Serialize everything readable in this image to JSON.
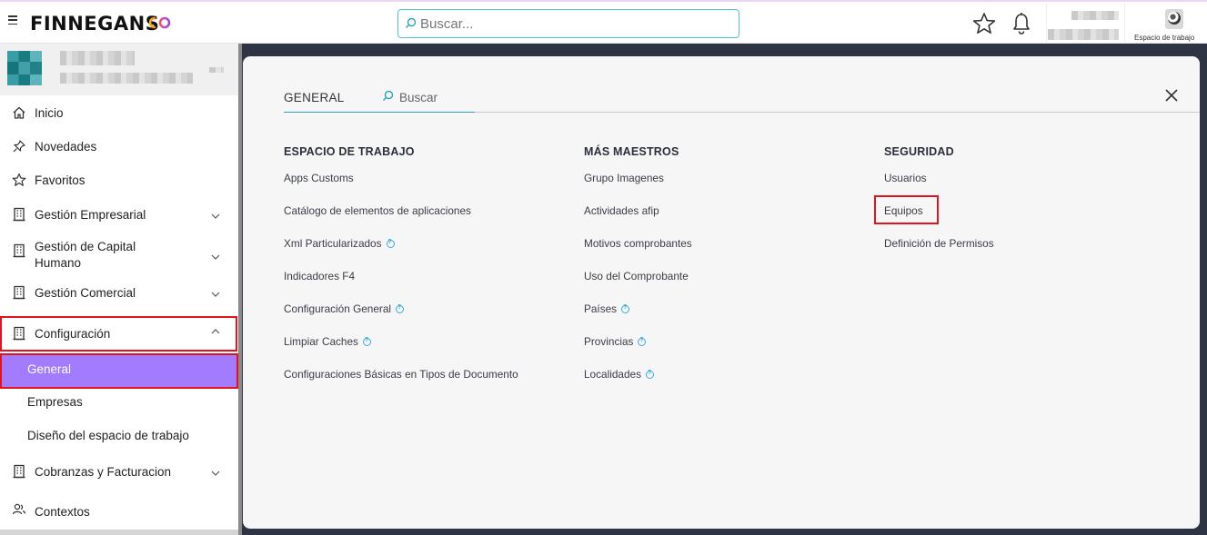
{
  "app": {
    "brand": "FINNEGANS"
  },
  "search": {
    "placeholder": "Buscar..."
  },
  "workspace": {
    "label": "Espacio de trabajo"
  },
  "sidebar": {
    "items": [
      {
        "label": "Inicio",
        "icon": "home-icon"
      },
      {
        "label": "Novedades",
        "icon": "pin-icon"
      },
      {
        "label": "Favoritos",
        "icon": "star-icon"
      },
      {
        "label": "Gestión Empresarial",
        "icon": "building-icon"
      },
      {
        "label": "Gestión de Capital Humano",
        "icon": "building-icon"
      },
      {
        "label": "Gestión Comercial",
        "icon": "building-icon"
      },
      {
        "label": "Configuración",
        "icon": "building-icon"
      },
      {
        "label": "Cobranzas y Facturacion",
        "icon": "building-icon"
      },
      {
        "label": "Contextos",
        "icon": "users-icon"
      }
    ],
    "config_sub": [
      {
        "label": "General"
      },
      {
        "label": "Empresas"
      },
      {
        "label": "Diseño del espacio de trabajo"
      }
    ]
  },
  "panel": {
    "tab": "GENERAL",
    "search_placeholder": "Buscar",
    "columns": [
      {
        "title": "ESPACIO DE TRABAJO",
        "links": [
          {
            "label": "Apps Customs",
            "help": false
          },
          {
            "label": "Catálogo de elementos de aplicaciones",
            "help": false
          },
          {
            "label": "Xml Particularizados",
            "help": true
          },
          {
            "label": "Indicadores F4",
            "help": false
          },
          {
            "label": "Configuración General",
            "help": true
          },
          {
            "label": "Limpiar Caches",
            "help": true
          },
          {
            "label": "Configuraciones Básicas en Tipos de Documento",
            "help": false
          }
        ]
      },
      {
        "title": "MÁS MAESTROS",
        "links": [
          {
            "label": "Grupo Imagenes",
            "help": false
          },
          {
            "label": "Actividades afip",
            "help": false
          },
          {
            "label": "Motivos comprobantes",
            "help": false
          },
          {
            "label": "Uso del Comprobante",
            "help": false
          },
          {
            "label": "Países",
            "help": true
          },
          {
            "label": "Provincias",
            "help": true
          },
          {
            "label": "Localidades",
            "help": true
          }
        ]
      },
      {
        "title": "SEGURIDAD",
        "links": [
          {
            "label": "Usuarios",
            "help": false
          },
          {
            "label": "Equipos",
            "help": false
          },
          {
            "label": "Definición de Permisos",
            "help": false
          }
        ]
      }
    ]
  },
  "colors": {
    "accent": "#a27bff",
    "highlight_border": "#e0141e",
    "search_border": "#4fc3d6",
    "panel_bg": "#f6f6f6",
    "backdrop": "#2f3445"
  }
}
